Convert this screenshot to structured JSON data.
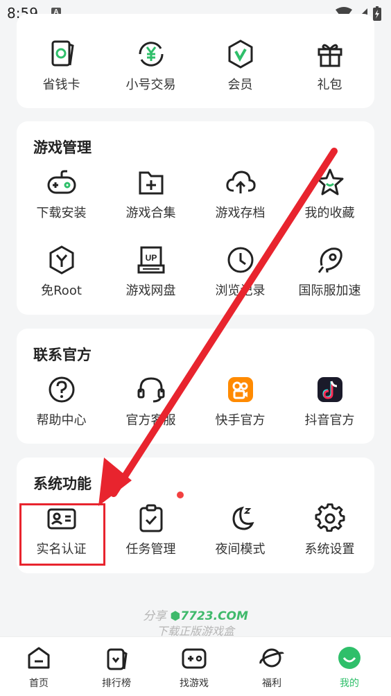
{
  "status_bar": {
    "time": "8:59",
    "notification_glyph": "A"
  },
  "quick_row": [
    {
      "label": "省钱卡",
      "icon": "card-icon"
    },
    {
      "label": "小号交易",
      "icon": "yen-exchange-icon"
    },
    {
      "label": "会员",
      "icon": "vip-badge-icon"
    },
    {
      "label": "礼包",
      "icon": "gift-icon"
    }
  ],
  "game_management": {
    "title": "游戏管理",
    "items": [
      {
        "label": "下载安装",
        "icon": "gamepad-icon"
      },
      {
        "label": "游戏合集",
        "icon": "folder-plus-icon"
      },
      {
        "label": "游戏存档",
        "icon": "cloud-upload-icon"
      },
      {
        "label": "我的收藏",
        "icon": "star-icon"
      },
      {
        "label": "免Root",
        "icon": "hexagon-y-icon"
      },
      {
        "label": "游戏网盘",
        "icon": "up-drive-icon"
      },
      {
        "label": "浏览记录",
        "icon": "clock-icon"
      },
      {
        "label": "国际服加速",
        "icon": "rocket-icon"
      }
    ]
  },
  "contact_official": {
    "title": "联系官方",
    "items": [
      {
        "label": "帮助中心",
        "icon": "question-icon"
      },
      {
        "label": "官方客服",
        "icon": "headset-icon"
      },
      {
        "label": "快手官方",
        "icon": "kuaishou-icon"
      },
      {
        "label": "抖音官方",
        "icon": "douyin-icon"
      }
    ]
  },
  "system_functions": {
    "title": "系统功能",
    "items": [
      {
        "label": "实名认证",
        "icon": "id-card-icon"
      },
      {
        "label": "任务管理",
        "icon": "clipboard-check-icon"
      },
      {
        "label": "夜间模式",
        "icon": "moon-icon"
      },
      {
        "label": "系统设置",
        "icon": "gear-icon"
      }
    ]
  },
  "footer": {
    "share_prefix": "分享",
    "brand": "7723.COM",
    "tagline": "下载正版游戏盒"
  },
  "bottom_nav": [
    {
      "label": "首页",
      "icon": "home-icon",
      "active": false
    },
    {
      "label": "排行榜",
      "icon": "ranking-icon",
      "active": false
    },
    {
      "label": "找游戏",
      "icon": "find-game-icon",
      "active": false
    },
    {
      "label": "福利",
      "icon": "planet-icon",
      "active": false
    },
    {
      "label": "我的",
      "icon": "profile-icon",
      "active": true
    }
  ],
  "colors": {
    "accent_green": "#2fbf6a",
    "annotation_red": "#e8242e",
    "background": "#f4f5f6"
  }
}
